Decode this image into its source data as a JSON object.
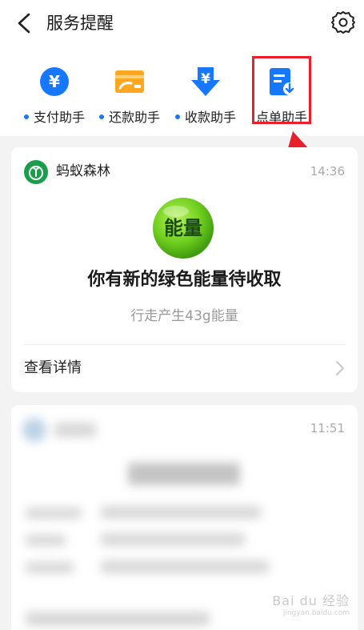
{
  "header": {
    "title": "服务提醒"
  },
  "tabs": [
    {
      "label": "支付助手",
      "icon": "yuan-circle-icon",
      "dot": true
    },
    {
      "label": "还款助手",
      "icon": "card-refund-icon",
      "dot": true
    },
    {
      "label": "收款助手",
      "icon": "yuan-down-arrow-icon",
      "dot": true
    },
    {
      "label": "点单助手",
      "icon": "order-doc-icon",
      "dot": false
    }
  ],
  "messages": [
    {
      "source": "蚂蚁森林",
      "time": "14:36",
      "badge_text": "能量",
      "headline": "你有新的绿色能量待收取",
      "subtitle": "行走产生43g能量",
      "action_label": "查看详情"
    },
    {
      "time": "11:51"
    }
  ],
  "watermark": {
    "brand": "Bai du 经验",
    "url": "jingyan.baidu.com"
  },
  "colors": {
    "accent_blue": "#1677ff",
    "highlight_red": "#e8202a",
    "energy_green": "#6fcf1e"
  }
}
